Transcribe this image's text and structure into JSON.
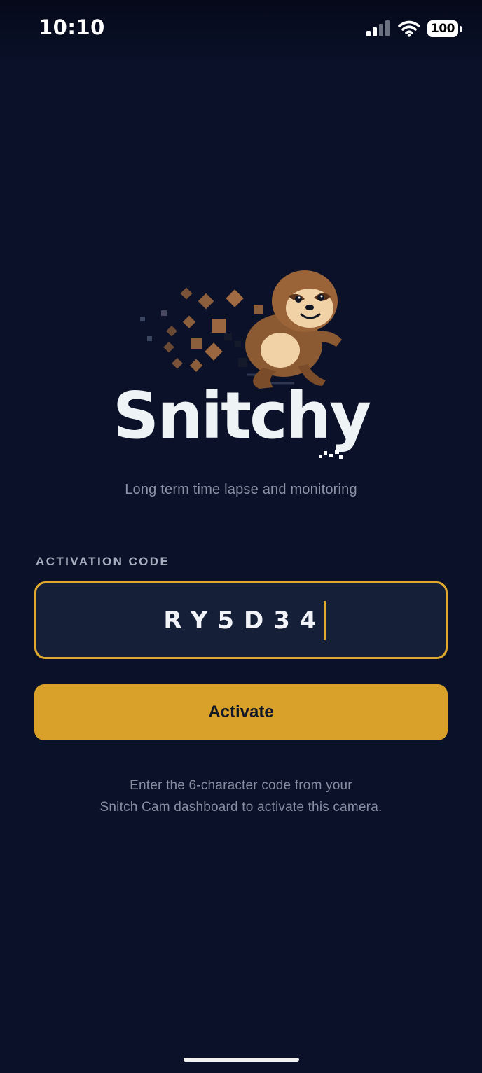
{
  "status_bar": {
    "time": "10:10",
    "battery_level": "100",
    "icons": [
      "signal-icon",
      "wifi-icon",
      "battery-icon"
    ]
  },
  "app": {
    "title": "Snitchy",
    "tagline": "Long term time lapse and monitoring",
    "logo": "sloth-mascot-icon"
  },
  "activation": {
    "label": "ACTIVATION CODE",
    "code_value": "RY5D34",
    "button_label": "Activate",
    "helper_line1": "Enter the 6-character code from your",
    "helper_line2": "Snitch Cam dashboard to activate this camera."
  },
  "colors": {
    "background": "#0a1128",
    "accent": "#d9a02a",
    "input_background": "#161f38",
    "muted_text": "#858ea3"
  }
}
